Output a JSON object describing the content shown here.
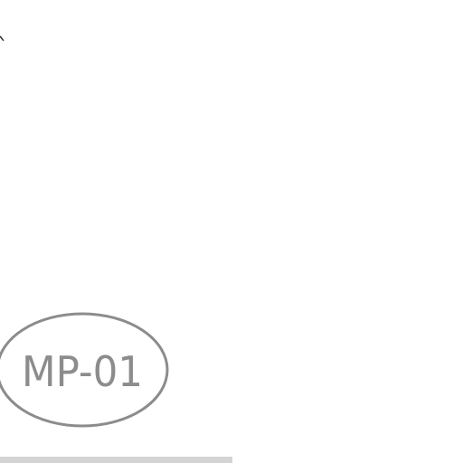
{
  "drawing": {
    "tag": {
      "label": "MP-01",
      "stroke_color": "#8c8c8c",
      "text_color": "#8c8c8c"
    },
    "footer_bar_color": "#d4d4d4",
    "corner_mark_color": "#333333"
  }
}
